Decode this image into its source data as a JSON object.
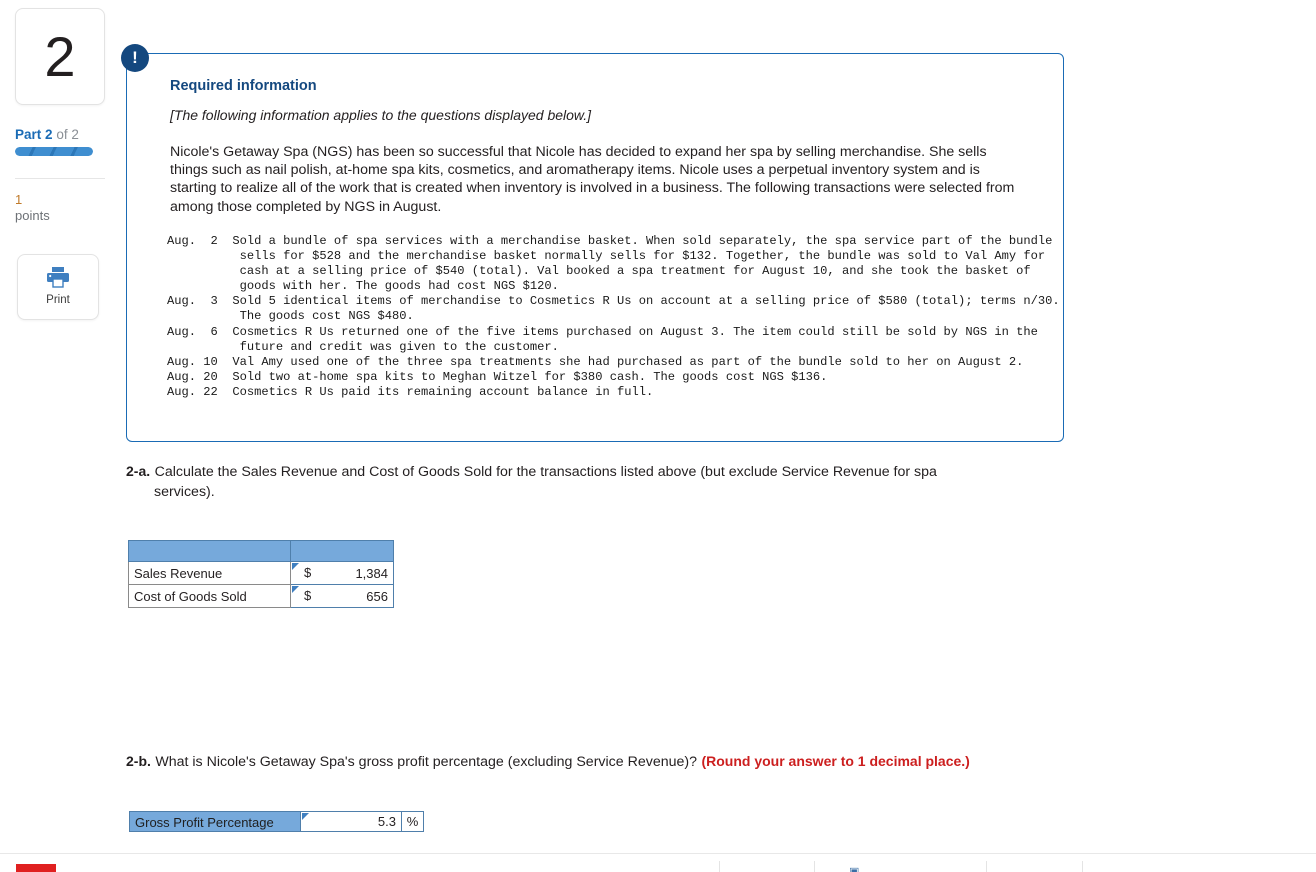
{
  "left_rail": {
    "question_number": "2",
    "part_prefix": "Part",
    "part_current": "2",
    "part_of": "of 2",
    "points_value": "1",
    "points_word": "points",
    "print_label": "Print",
    "print_icon": "printer-icon",
    "progress_percent": 100
  },
  "info_box": {
    "badge_glyph": "!",
    "heading": "Required information",
    "applies_note": "[The following information applies to the questions displayed below.]",
    "intro_paragraph": "Nicole's Getaway Spa (NGS) has been so successful that Nicole has decided to expand her spa by selling merchandise. She sells things such as nail polish, at-home spa kits, cosmetics, and aromatherapy items. Nicole uses a perpetual inventory system and is starting to realize all of the work that is created when inventory is involved in a business. The following transactions were selected from among those completed by NGS in August.",
    "transactions_text": "Aug.  2  Sold a bundle of spa services with a merchandise basket. When sold separately, the spa service part of the bundle\n          sells for $528 and the merchandise basket normally sells for $132. Together, the bundle was sold to Val Amy for\n          cash at a selling price of $540 (total). Val booked a spa treatment for August 10, and she took the basket of\n          goods with her. The goods had cost NGS $120.\nAug.  3  Sold 5 identical items of merchandise to Cosmetics R Us on account at a selling price of $580 (total); terms n/30.\n          The goods cost NGS $480.\nAug.  6  Cosmetics R Us returned one of the five items purchased on August 3. The item could still be sold by NGS in the\n          future and credit was given to the customer.\nAug. 10  Val Amy used one of the three spa treatments she had purchased as part of the bundle sold to her on August 2.\nAug. 20  Sold two at-home spa kits to Meghan Witzel for $380 cash. The goods cost NGS $136.\nAug. 22  Cosmetics R Us paid its remaining account balance in full."
  },
  "question_a": {
    "tag": "2-a.",
    "text_line1": "Calculate the Sales Revenue and Cost of Goods Sold for the transactions listed above (but exclude Service Revenue for spa",
    "text_line2": "services).",
    "table": {
      "rows": [
        {
          "label": "Sales Revenue",
          "currency": "$",
          "value": "1,384"
        },
        {
          "label": "Cost of Goods Sold",
          "currency": "$",
          "value": "656"
        }
      ]
    }
  },
  "question_b": {
    "tag": "2-b.",
    "text": "What is Nicole's Getaway Spa's gross profit percentage (excluding Service Revenue)?",
    "warning": "(Round your answer to 1 decimal place.)",
    "answer": {
      "label": "Gross Profit Percentage",
      "value": "5.3",
      "unit": "%"
    }
  },
  "colors": {
    "accent_blue": "#1a6bb5",
    "badge_navy": "#14487f",
    "table_header_blue": "#76a9db",
    "cell_border_blue": "#4f7fab",
    "warning_red": "#cc1f1f",
    "points_orange": "#c07a2a",
    "footer_red": "#e02020"
  }
}
